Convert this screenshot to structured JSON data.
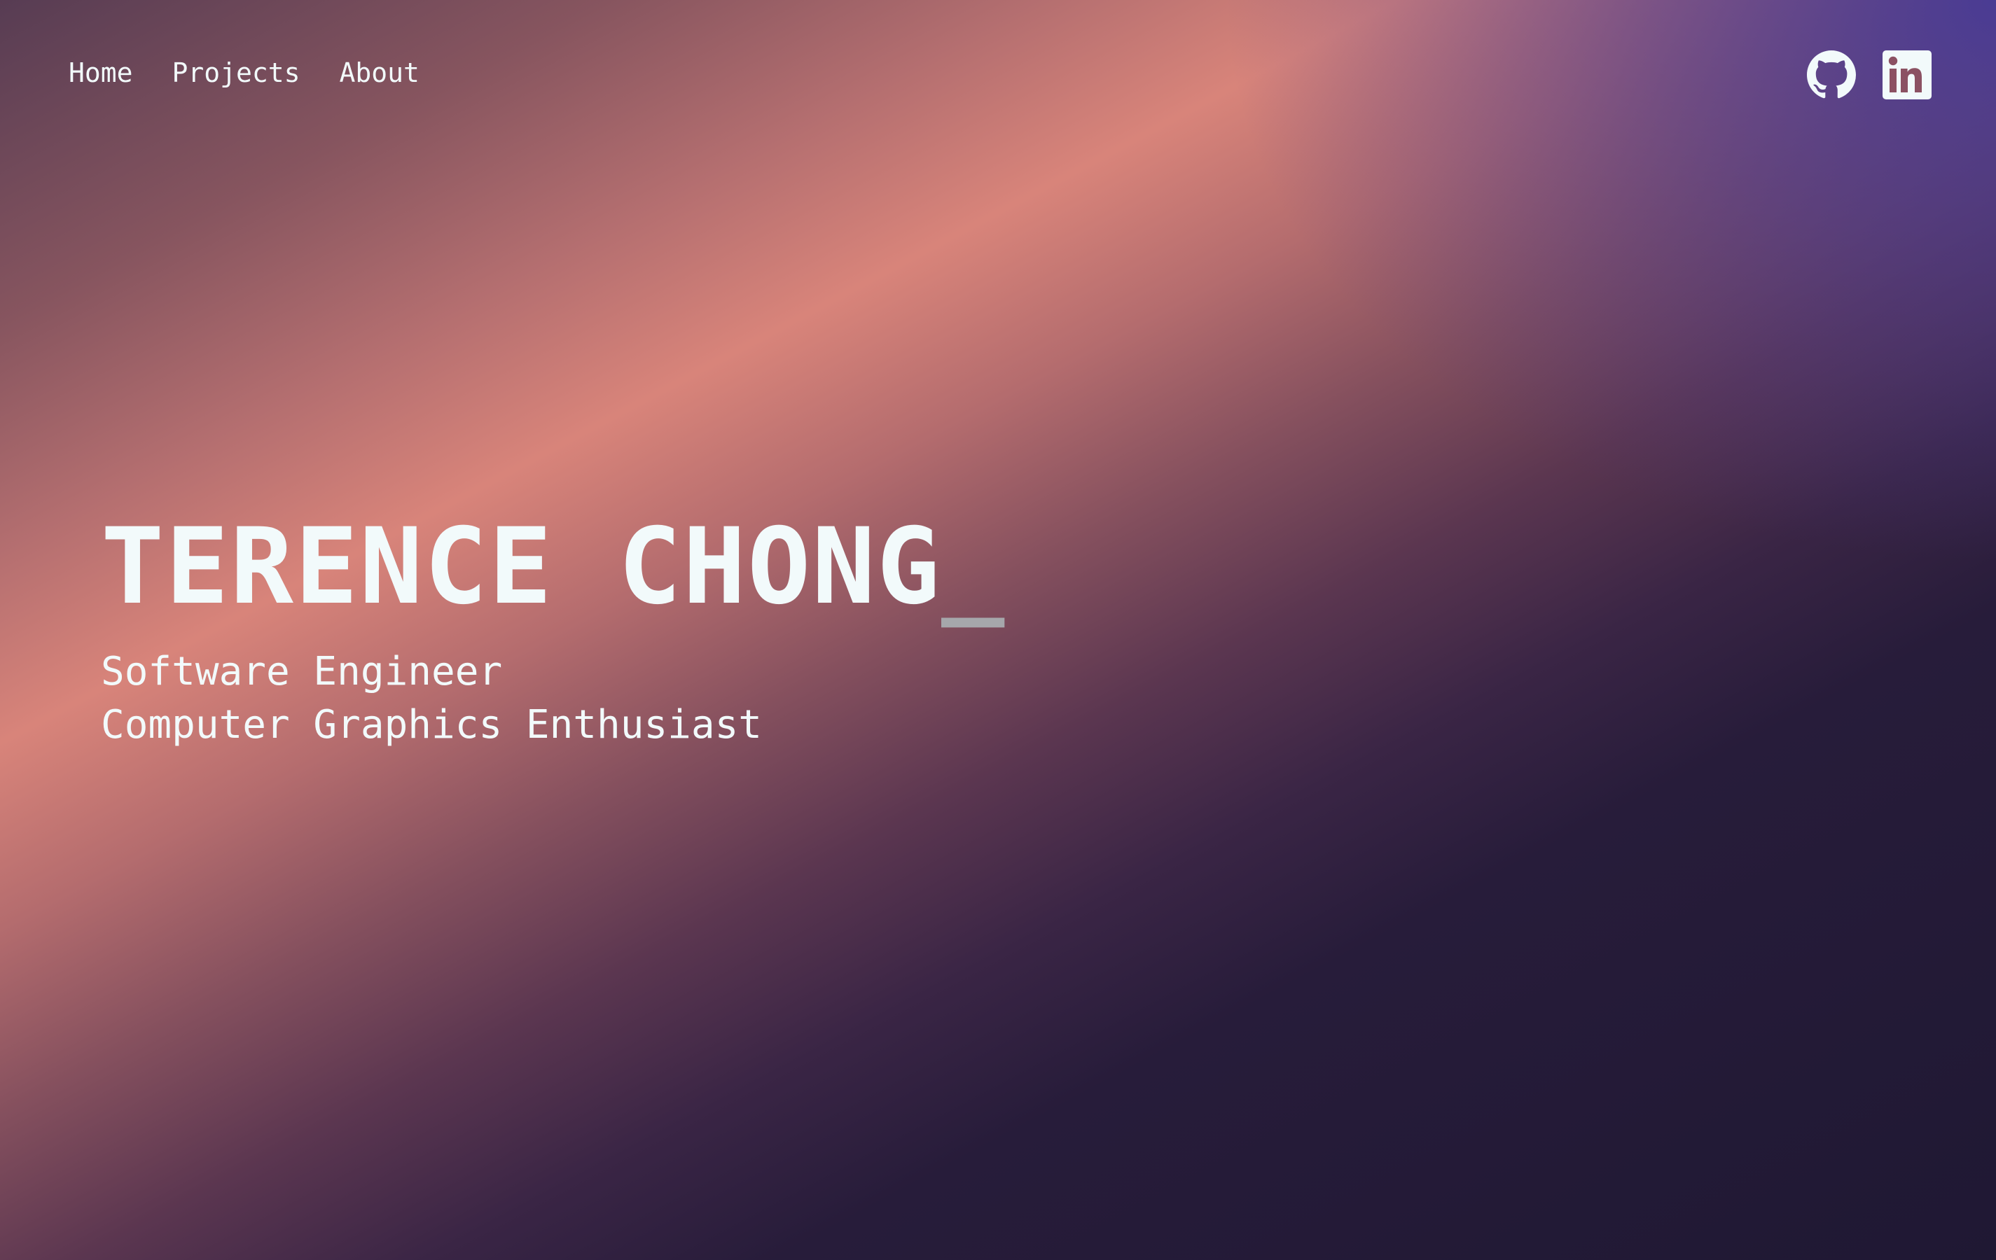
{
  "nav": {
    "items": [
      {
        "label": "Home"
      },
      {
        "label": "Projects"
      },
      {
        "label": "About"
      }
    ]
  },
  "social": {
    "github_icon": "github-icon",
    "linkedin_icon": "linkedin-icon"
  },
  "hero": {
    "name": "TERENCE CHONG",
    "cursor": "_",
    "subtitle_lines": [
      "Software Engineer",
      "Computer Graphics Enthusiast"
    ]
  },
  "colors": {
    "text": "#f2fafb",
    "cursor": "#a6a7ab",
    "accent_peach": "#d8847a",
    "accent_indigo": "#463a96",
    "background_dark": "#1f1833"
  }
}
